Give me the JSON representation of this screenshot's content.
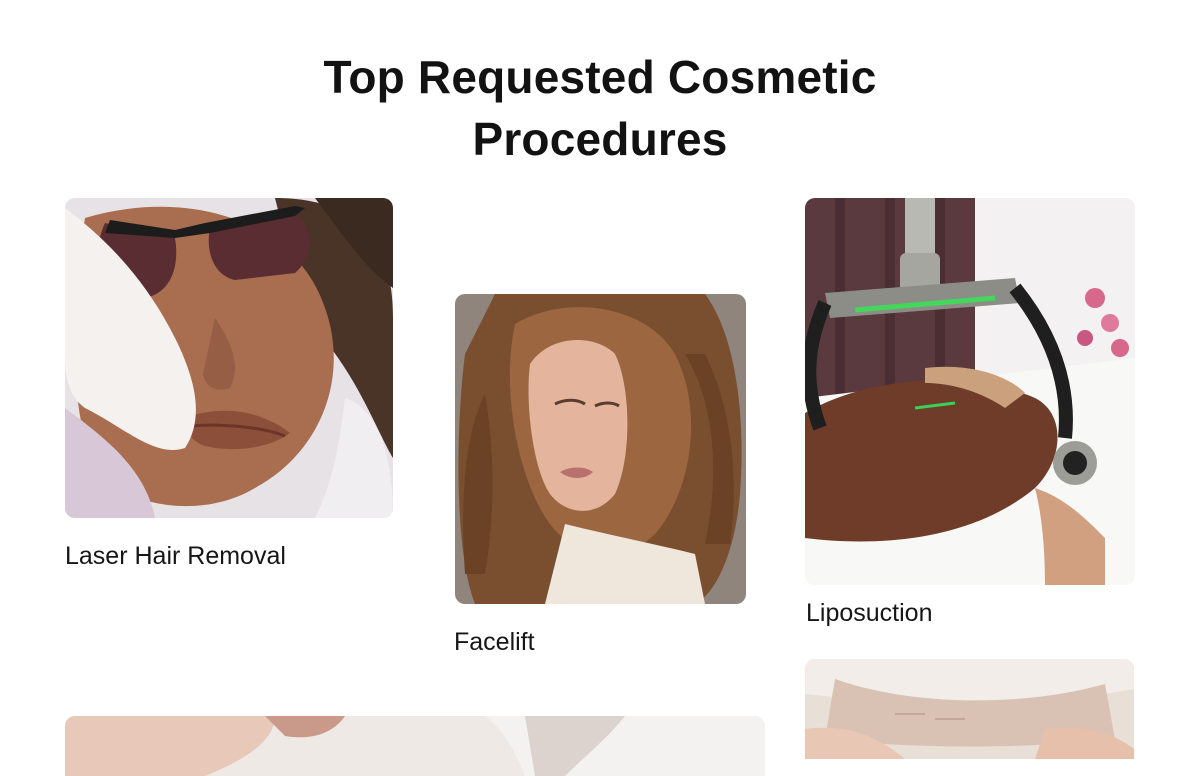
{
  "section": {
    "title": "Top Requested Cosmetic Procedures"
  },
  "procedures": [
    {
      "label": "Laser Hair Removal"
    },
    {
      "label": "Facelift"
    },
    {
      "label": "Liposuction"
    }
  ],
  "colors": {
    "heading": "#121212",
    "background": "#ffffff"
  }
}
